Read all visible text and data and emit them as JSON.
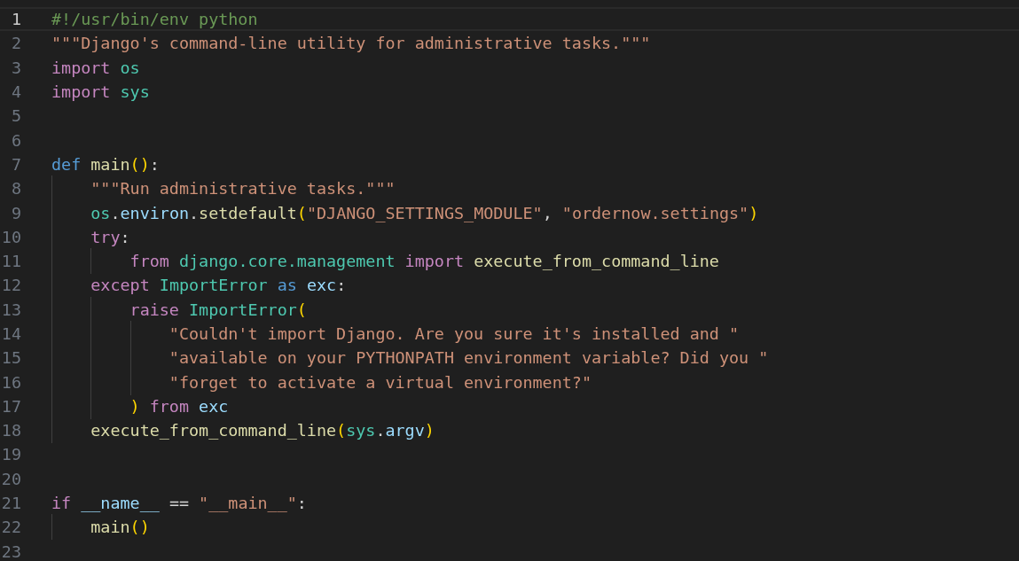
{
  "editor": {
    "lines": [
      {
        "number": "1",
        "selected": true,
        "tokens": [
          {
            "kind": "comment",
            "text": "#!/usr/bin/env python"
          }
        ]
      },
      {
        "number": "2",
        "selected": false,
        "tokens": [
          {
            "kind": "string",
            "text": "\"\"\"Django's command-line utility for administrative tasks.\"\"\""
          }
        ]
      },
      {
        "number": "3",
        "selected": false,
        "tokens": [
          {
            "kind": "keyword",
            "text": "import"
          },
          {
            "kind": "module",
            "text": " os"
          }
        ]
      },
      {
        "number": "4",
        "selected": false,
        "tokens": [
          {
            "kind": "keyword",
            "text": "import"
          },
          {
            "kind": "module",
            "text": " sys"
          }
        ]
      },
      {
        "number": "5",
        "selected": false
      },
      {
        "number": "6",
        "selected": false
      },
      {
        "number": "7",
        "selected": false,
        "tokens": [
          {
            "kind": "storage",
            "text": "def"
          },
          {
            "kind": "function",
            "text": " main"
          },
          {
            "kind": "bracket",
            "text": "()"
          },
          {
            "kind": "plain",
            "text": ":"
          }
        ]
      },
      {
        "number": "8",
        "selected": false,
        "tokens": [
          {
            "kind": "string",
            "text": "    \"\"\"Run administrative tasks.\"\"\""
          }
        ]
      },
      {
        "number": "9",
        "selected": false,
        "tokens": [
          {
            "kind": "module",
            "text": "    os"
          },
          {
            "kind": "plain",
            "text": "."
          },
          {
            "kind": "variable",
            "text": "environ"
          },
          {
            "kind": "plain",
            "text": "."
          },
          {
            "kind": "function",
            "text": "setdefault"
          },
          {
            "kind": "bracket",
            "text": "("
          },
          {
            "kind": "string",
            "text": "\"DJANGO_SETTINGS_MODULE\""
          },
          {
            "kind": "plain",
            "text": ","
          },
          {
            "kind": "string",
            "text": " \"ordernow.settings\""
          },
          {
            "kind": "bracket",
            "text": ")"
          }
        ]
      },
      {
        "number": "10",
        "selected": false,
        "tokens": [
          {
            "kind": "keyword",
            "text": "    try"
          },
          {
            "kind": "plain",
            "text": ":"
          }
        ]
      },
      {
        "number": "11",
        "selected": false,
        "tokens": [
          {
            "kind": "keyword",
            "text": "        from"
          },
          {
            "kind": "module",
            "text": " django.core.management"
          },
          {
            "kind": "keyword",
            "text": " import"
          },
          {
            "kind": "function",
            "text": " execute_from_command_line"
          }
        ]
      },
      {
        "number": "12",
        "selected": false,
        "tokens": [
          {
            "kind": "keyword",
            "text": "    except"
          },
          {
            "kind": "module",
            "text": " ImportError"
          },
          {
            "kind": "storage",
            "text": " as"
          },
          {
            "kind": "variable",
            "text": " exc"
          },
          {
            "kind": "plain",
            "text": ":"
          }
        ]
      },
      {
        "number": "13",
        "selected": false,
        "tokens": [
          {
            "kind": "keyword",
            "text": "        raise"
          },
          {
            "kind": "module",
            "text": " ImportError"
          },
          {
            "kind": "bracket",
            "text": "("
          }
        ]
      },
      {
        "number": "14",
        "selected": false,
        "tokens": [
          {
            "kind": "string",
            "text": "            \"Couldn't import Django. Are you sure it's installed and \""
          }
        ]
      },
      {
        "number": "15",
        "selected": false,
        "tokens": [
          {
            "kind": "string",
            "text": "            \"available on your PYTHONPATH environment variable? Did you \""
          }
        ]
      },
      {
        "number": "16",
        "selected": false,
        "tokens": [
          {
            "kind": "string",
            "text": "            \"forget to activate a virtual environment?\""
          }
        ]
      },
      {
        "number": "17",
        "selected": false,
        "tokens": [
          {
            "kind": "bracket",
            "text": "        )"
          },
          {
            "kind": "keyword",
            "text": " from"
          },
          {
            "kind": "variable",
            "text": " exc"
          }
        ]
      },
      {
        "number": "18",
        "selected": false,
        "tokens": [
          {
            "kind": "function",
            "text": "    execute_from_command_line"
          },
          {
            "kind": "bracket",
            "text": "("
          },
          {
            "kind": "module",
            "text": "sys"
          },
          {
            "kind": "plain",
            "text": "."
          },
          {
            "kind": "variable",
            "text": "argv"
          },
          {
            "kind": "bracket",
            "text": ")"
          }
        ]
      },
      {
        "number": "19",
        "selected": false
      },
      {
        "number": "20",
        "selected": false
      },
      {
        "number": "21",
        "selected": false,
        "tokens": [
          {
            "kind": "keyword",
            "text": "if"
          },
          {
            "kind": "variable",
            "text": " __name__"
          },
          {
            "kind": "plain",
            "text": " =="
          },
          {
            "kind": "string",
            "text": " \"__main__\""
          },
          {
            "kind": "plain",
            "text": ":"
          }
        ]
      },
      {
        "number": "22",
        "selected": false,
        "tokens": [
          {
            "kind": "function",
            "text": "    main"
          },
          {
            "kind": "bracket",
            "text": "()"
          }
        ]
      },
      {
        "number": "23",
        "selected": false
      }
    ]
  }
}
